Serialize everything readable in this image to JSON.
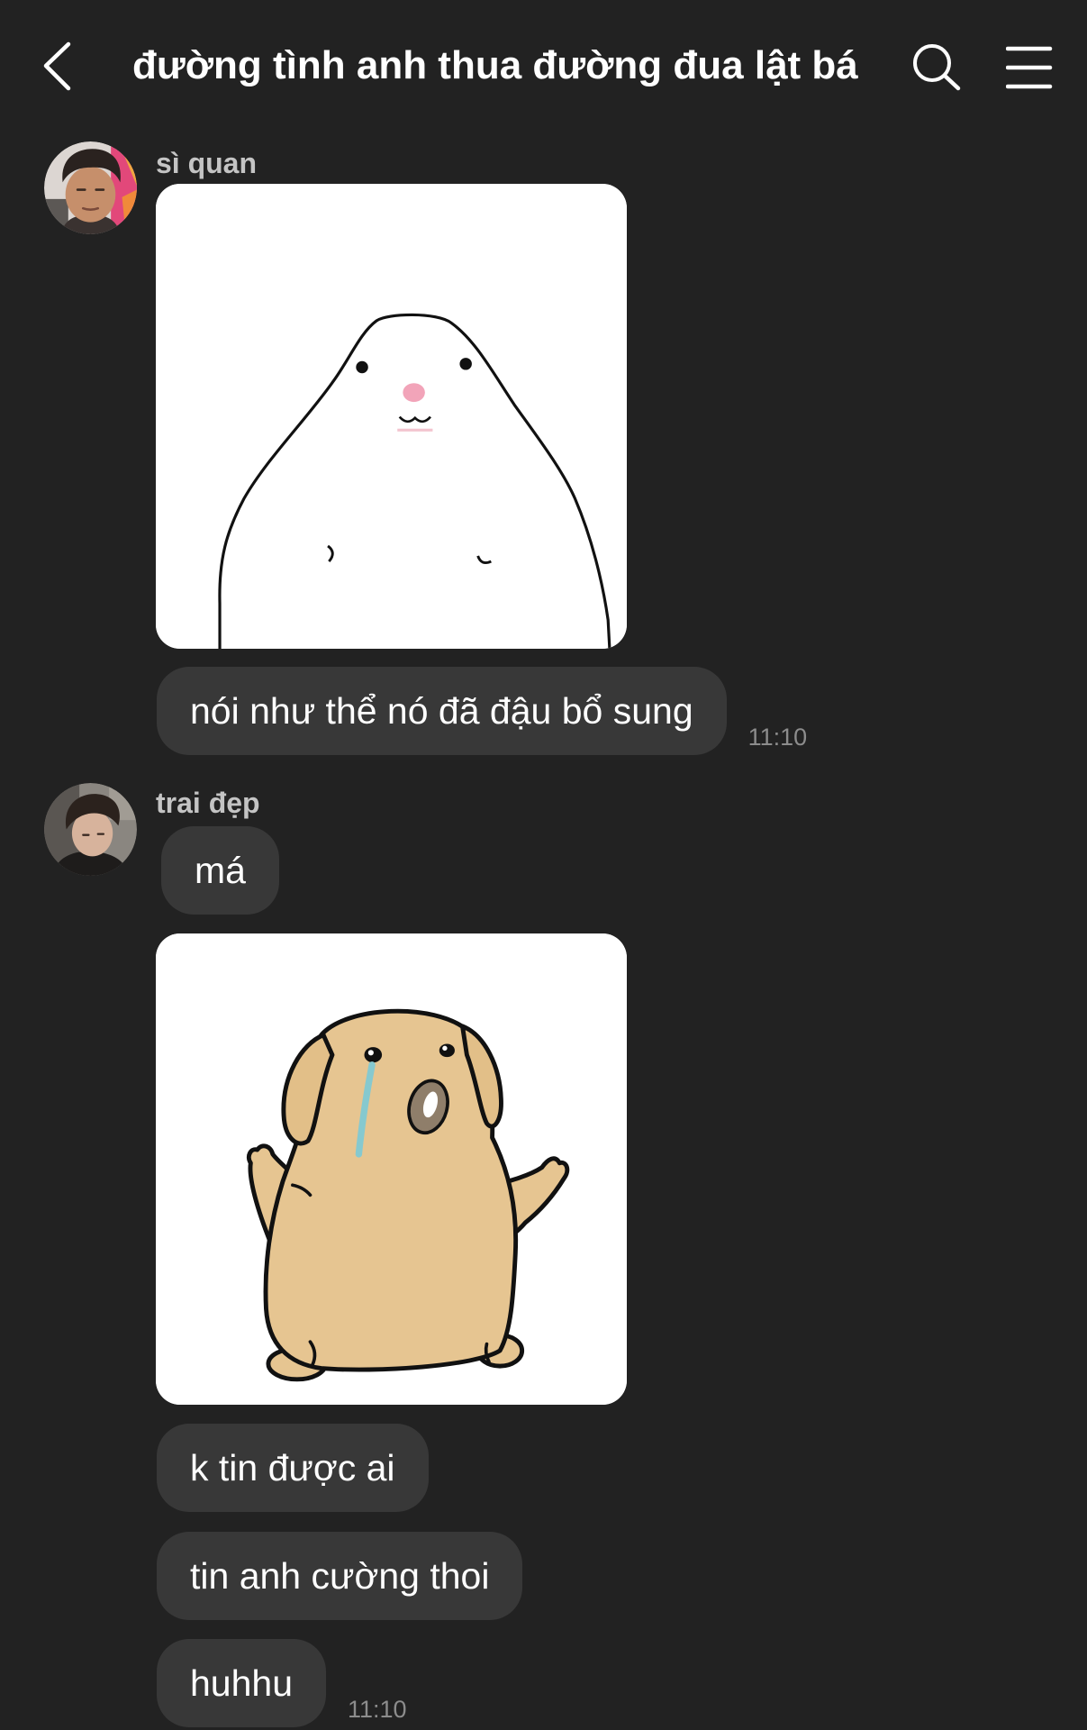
{
  "header": {
    "title": "đường tình anh thua đường đua lật bá",
    "back_icon": "chevron-left-icon",
    "search_icon": "search-icon",
    "menu_icon": "menu-icon"
  },
  "colors": {
    "background": "#222222",
    "bubble": "#383838",
    "text": "#ffffff",
    "sender_name": "#c4c4c4",
    "timestamp": "#8c8c8c"
  },
  "messages": [
    {
      "sender": "sì quan",
      "texts": [
        "nói như thể nó đã đậu bổ sung"
      ],
      "time": "11:10"
    },
    {
      "sender": "trai đẹp",
      "texts": [
        "má",
        "k tin được ai",
        "tin anh cường thoi",
        "huhhu"
      ],
      "time": "11:10"
    }
  ]
}
